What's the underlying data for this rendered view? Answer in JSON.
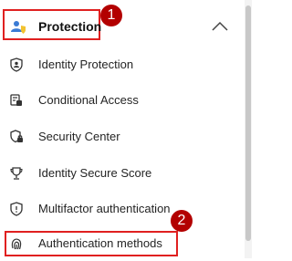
{
  "header": {
    "label": "Protection",
    "callout": "1",
    "icon": "users-shield-icon",
    "chevron": "chevron-up-icon"
  },
  "items": [
    {
      "label": "Identity Protection",
      "icon": "shield-person-icon"
    },
    {
      "label": "Conditional Access",
      "icon": "conditional-access-icon"
    },
    {
      "label": "Security Center",
      "icon": "shield-lock-icon"
    },
    {
      "label": "Identity Secure Score",
      "icon": "trophy-icon"
    },
    {
      "label": "Multifactor authentication",
      "icon": "shield-icon"
    },
    {
      "label": "Authentication methods",
      "icon": "fingerprint-icon"
    }
  ],
  "callout_2": "2",
  "colors": {
    "highlight_border": "#e02020",
    "callout_fill": "#b30000"
  }
}
